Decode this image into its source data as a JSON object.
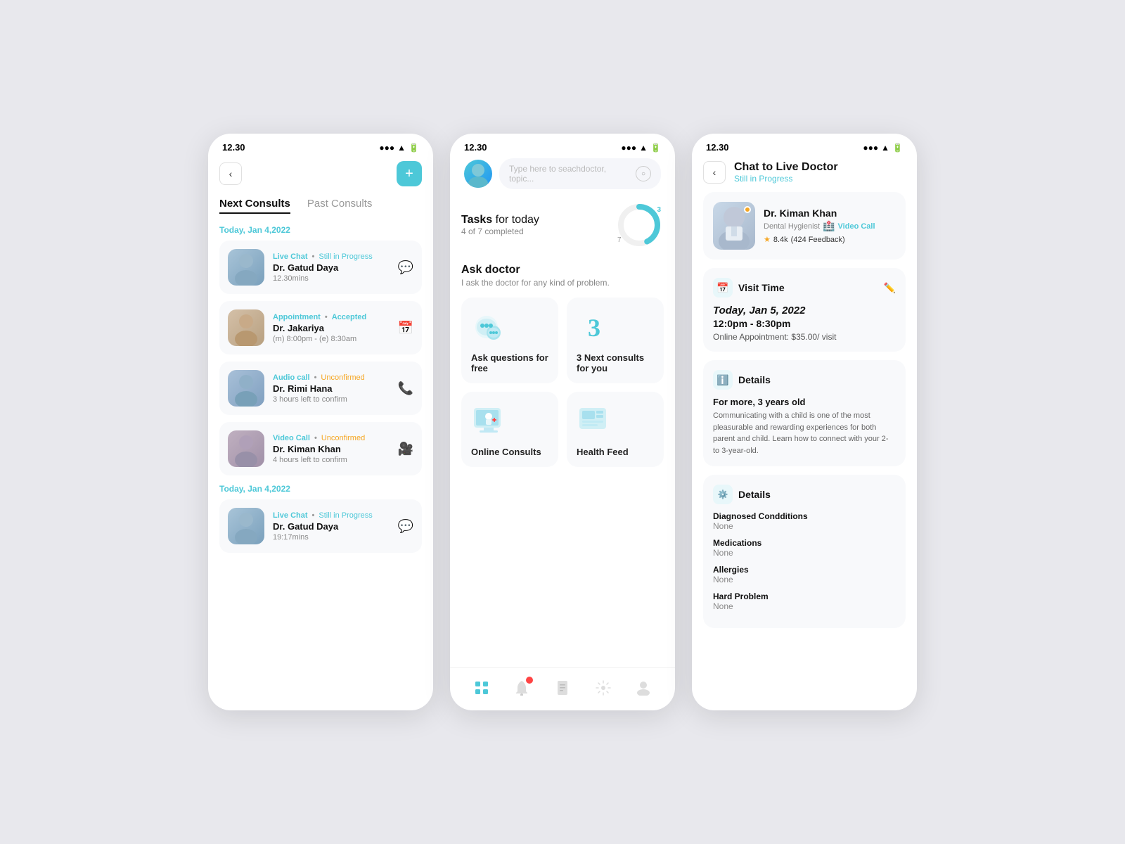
{
  "statusBar": {
    "time": "12.30",
    "icons": "●●● ↑ 🔋"
  },
  "phone1": {
    "tabs": {
      "active": "Next Consults",
      "inactive": "Past Consults"
    },
    "sections": [
      {
        "date": "Today, Jan 4,2022",
        "consults": [
          {
            "type": "Live Chat",
            "status": "Still in Progress",
            "name": "Dr. Gatud Daya",
            "sub": "12.30mins",
            "icon": "💬",
            "avatarBg": "#b0c8d8"
          },
          {
            "type": "Appointment",
            "status": "Accepted",
            "name": "Dr. Jakariya",
            "sub": "(m) 8:00pm - (e) 8:30am",
            "icon": "📅",
            "avatarBg": "#c8b8a0"
          },
          {
            "type": "Audio call",
            "status": "Unconfirmed",
            "name": "Dr. Rimi Hana",
            "sub": "3 hours left to confirm",
            "icon": "📞",
            "avatarBg": "#a0b8c8"
          },
          {
            "type": "Video Call",
            "status": "Unconfirmed",
            "name": "Dr. Kiman Khan",
            "sub": "4 hours left to confirm",
            "icon": "🎥",
            "avatarBg": "#b8a0a8"
          }
        ]
      },
      {
        "date": "Today, Jan 4,2022",
        "consults": [
          {
            "type": "Live Chat",
            "status": "Still in Progress",
            "name": "Dr. Gatud Daya",
            "sub": "19:17mins",
            "icon": "💬",
            "avatarBg": "#b0c8d8"
          }
        ]
      }
    ]
  },
  "phone2": {
    "searchPlaceholder": "Type here to seachdoctor, topic...",
    "tasks": {
      "title": "Tasks",
      "titleSuffix": " for today",
      "subtitle": "4 of 7 completed",
      "completed": 4,
      "total": 7
    },
    "askDoctor": {
      "title": "Ask doctor",
      "subtitle": "I ask the doctor for any kind of problem."
    },
    "gridItems": [
      {
        "label": "Ask questions for free",
        "icon": "bubble"
      },
      {
        "label": "3 Next consults for you",
        "icon": "num3"
      },
      {
        "label": "Online Consults",
        "icon": "online"
      },
      {
        "label": "Health Feed",
        "icon": "feed"
      }
    ],
    "bottomNav": [
      {
        "icon": "🏠",
        "active": true
      },
      {
        "icon": "🔔",
        "active": false,
        "badge": true
      },
      {
        "icon": "📄",
        "active": false
      },
      {
        "icon": "⚙️",
        "active": false
      },
      {
        "icon": "👤",
        "active": false
      }
    ]
  },
  "phone3": {
    "pageTitle": "Chat to Live Doctor",
    "pageSubtitle": "Still in Progress",
    "doctor": {
      "name": "Dr. Kiman Khan",
      "specialty": "Dental Hygienist",
      "callType": "Video Call",
      "rating": "8.4k",
      "feedback": "(424 Feedback)"
    },
    "visitTime": {
      "title": "Visit Time",
      "date": "Today, Jan 5, 2022",
      "time": "12:0pm - 8:30pm",
      "cost": "Online Appointment: $35.00/ visit"
    },
    "details": {
      "title": "Details",
      "forMore": "For more, 3 years old",
      "description": "Communicating with a child is one of the most pleasurable and rewarding experiences for both parent and child. Learn how to connect with your 2- to 3-year-old."
    },
    "diagnosed": {
      "title": "Details",
      "rows": [
        {
          "label": "Diagnosed Condditions",
          "value": "None"
        },
        {
          "label": "Medications",
          "value": "None"
        },
        {
          "label": "Allergies",
          "value": "None"
        },
        {
          "label": "Hard Problem",
          "value": "None"
        }
      ]
    }
  }
}
